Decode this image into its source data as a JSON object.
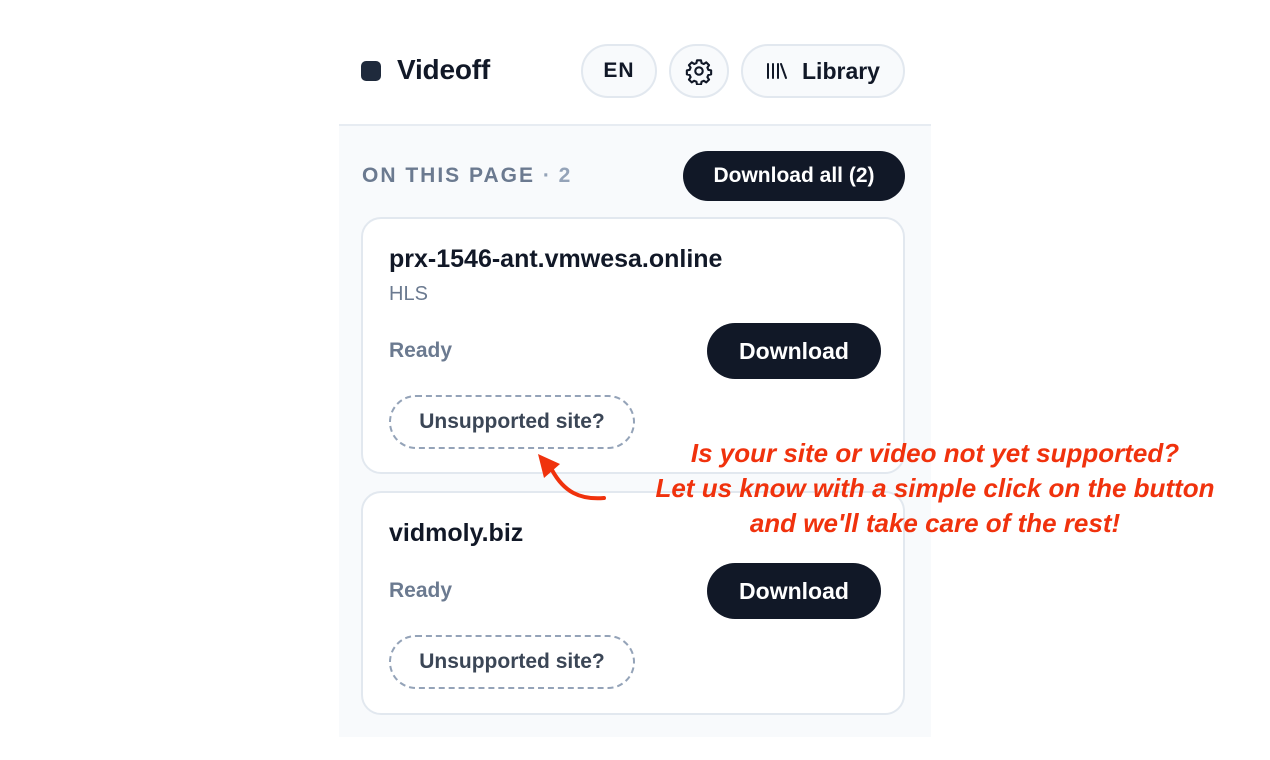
{
  "header": {
    "brand": "Videoff",
    "language": "EN",
    "library_label": "Library",
    "settings_icon": "gear-icon",
    "library_icon": "library-icon"
  },
  "section": {
    "label": "ON THIS PAGE",
    "separator": "·",
    "count": "2",
    "download_all_label": "Download all (2)"
  },
  "items": [
    {
      "title": "prx-1546-ant.vmwesa.online",
      "format": "HLS",
      "status": "Ready",
      "download_label": "Download",
      "unsupported_label": "Unsupported site?"
    },
    {
      "title": "vidmoly.biz",
      "status": "Ready",
      "download_label": "Download",
      "unsupported_label": "Unsupported site?"
    }
  ],
  "annotation": {
    "lines": [
      "Is your site or video not yet supported?",
      "Let us know with a simple click on the button",
      "and we'll take care of the rest!"
    ],
    "color": "#f0320d"
  },
  "colors": {
    "primary_button": "#111827",
    "panel_background": "#f8fafc",
    "muted_text": "#6b7a90"
  }
}
